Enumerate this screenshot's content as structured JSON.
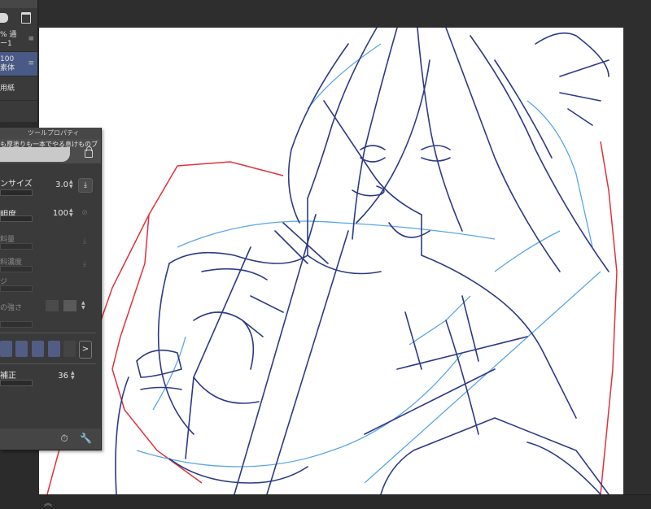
{
  "layers": {
    "items": [
      {
        "line1": "% 通",
        "line2": "ー1",
        "selected": false
      },
      {
        "line1": "100",
        "line2": "素体",
        "selected": true
      },
      {
        "line1": "用紙",
        "line2": "",
        "selected": false
      }
    ],
    "menu_glyph": "≡"
  },
  "tool_property": {
    "title": "ツールプロパティ",
    "preset_name": "も厚塗りも一本でやる息けものブラ",
    "brush_size": {
      "label": "ンサイズ",
      "value": "3.0",
      "fraction": 0.55
    },
    "opacity": {
      "label": "明度",
      "value": "100",
      "fraction": 1.0
    },
    "dim_labels": [
      "料量",
      "料濃度",
      "ジ",
      "の強さ"
    ],
    "stabilization": {
      "label": "補正",
      "value": "36",
      "fraction": 0.3
    },
    "next_glyph": ">"
  },
  "colors": {
    "accent": "#4a5a86",
    "panel_bg": "#3a3a3a",
    "sketch_dark": "#2e3a86",
    "sketch_light": "#5aa6e6",
    "sketch_red": "#e0323c"
  }
}
